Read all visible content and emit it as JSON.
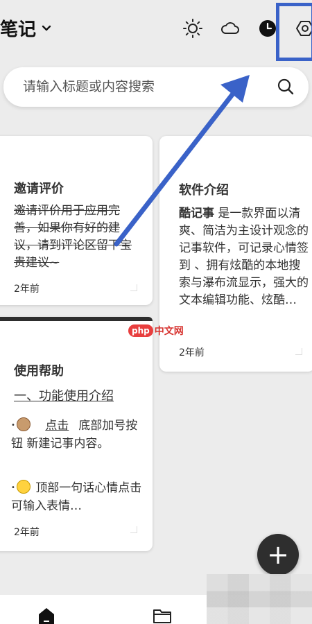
{
  "header": {
    "title": "笔记",
    "icons": [
      "chevron-down-icon",
      "sun-icon",
      "cloud-icon",
      "clock-icon",
      "settings-icon"
    ]
  },
  "search": {
    "placeholder": "请输入标题或内容搜索"
  },
  "cards": [
    {
      "title": "邀请评价",
      "body": "邀请评价用于应用完善，如果你有好的建议，请到评论区留下宝贵建议~",
      "date": "2年前"
    },
    {
      "title": "软件介绍",
      "body_lead": "酷记事",
      "body_rest": " 是一款界面以清爽、简洁为主设计观念的记事软件，可记录心情签到 、拥有炫酷的本地搜索与瀑布流显示，强大的文本编辑功能、炫酷…",
      "date": "2年前"
    },
    {
      "title": "使用帮助",
      "subheading": "一、功能使用介绍",
      "item1_pre": "",
      "item1_link": "点击",
      "item1_post": "底部加号按钮 新建记事内容。",
      "item2": "顶部一句话心情点击可输入表情…",
      "date": "2年前"
    }
  ],
  "watermark": {
    "badge": "php",
    "text": "中文网"
  },
  "fab": {
    "label": "+"
  },
  "colors": {
    "highlight": "#3a62c8",
    "fab": "#2e2e2e",
    "background": "#ececec"
  }
}
